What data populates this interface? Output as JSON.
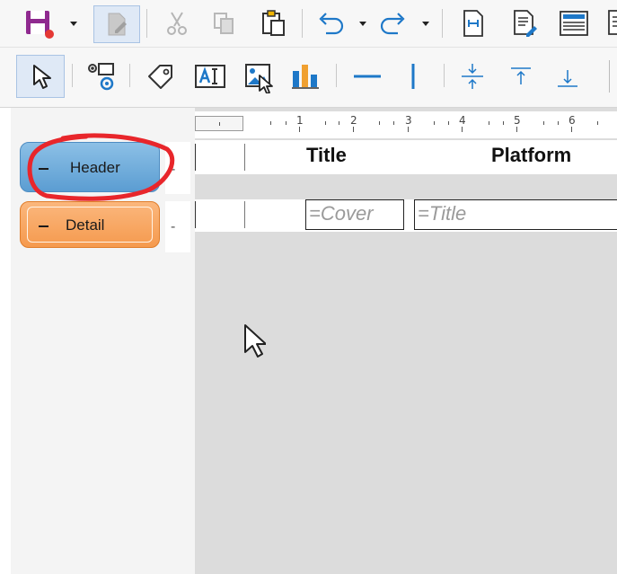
{
  "toolbar1": {
    "items": [
      {
        "name": "save",
        "icon": "save-icon"
      },
      {
        "name": "edit",
        "icon": "edit-document-icon"
      },
      {
        "name": "cut",
        "icon": "cut-icon"
      },
      {
        "name": "copy",
        "icon": "copy-icon"
      },
      {
        "name": "paste",
        "icon": "paste-icon"
      },
      {
        "name": "undo",
        "icon": "undo-icon"
      },
      {
        "name": "redo",
        "icon": "redo-icon"
      },
      {
        "name": "report-header-footer",
        "icon": "report-header-footer-icon"
      },
      {
        "name": "page-header",
        "icon": "page-header-icon"
      },
      {
        "name": "add-field",
        "icon": "add-field-icon"
      },
      {
        "name": "sort",
        "icon": "sorting-grouping-icon"
      }
    ]
  },
  "toolbar2": {
    "items": [
      {
        "name": "select",
        "icon": "pointer-icon",
        "active": true
      },
      {
        "name": "form-control",
        "icon": "form-control-icon"
      },
      {
        "name": "label",
        "icon": "label-tag-icon"
      },
      {
        "name": "text-box",
        "icon": "text-box-icon"
      },
      {
        "name": "image",
        "icon": "image-icon"
      },
      {
        "name": "chart",
        "icon": "chart-icon"
      },
      {
        "name": "horizontal-line",
        "icon": "horizontal-line-icon"
      },
      {
        "name": "vertical-line",
        "icon": "vertical-line-icon"
      },
      {
        "name": "center-vertically",
        "icon": "center-vertically-icon"
      },
      {
        "name": "align-top",
        "icon": "align-top-icon"
      },
      {
        "name": "align-bottom",
        "icon": "align-bottom-icon"
      }
    ]
  },
  "ruler": {
    "numbers": [
      "1",
      "2",
      "3",
      "4",
      "5",
      "6"
    ]
  },
  "sections": {
    "header": {
      "label": "Header",
      "collapse_symbol": "-"
    },
    "detail": {
      "label": "Detail",
      "collapse_symbol": "-"
    }
  },
  "report": {
    "header_labels": {
      "title": "Title",
      "platform": "Platform"
    },
    "detail_fields": {
      "cover": "=Cover",
      "title": "=Title"
    }
  },
  "colors": {
    "header_section": "#6aa9dc",
    "detail_section": "#f7a55f",
    "annotation_circle": "#e8262b",
    "accent_blue": "#1e78c8"
  }
}
